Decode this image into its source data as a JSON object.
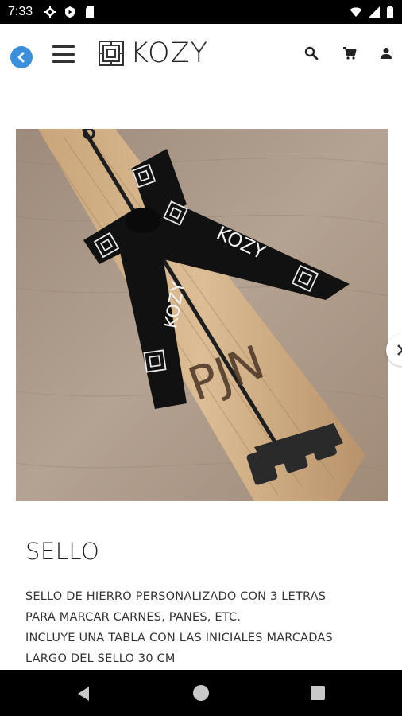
{
  "status_bar": {
    "time": "7:33",
    "left_icons": [
      "settings-icon",
      "play-protect-icon",
      "sd-card-icon"
    ],
    "right_icons": [
      "wifi-icon",
      "signal-icon",
      "battery-icon"
    ]
  },
  "header": {
    "back_icon": "arrow-left-icon",
    "menu_icon": "hamburger-icon",
    "logo_text": "KOZY",
    "actions": [
      "search-icon",
      "cart-icon",
      "user-icon"
    ],
    "accent_color": "#3d8fd9"
  },
  "product": {
    "image_alt": "Sello de hierro con tabla de madera y lazo KOZY",
    "ribbon_text": "KOZY",
    "stamp_letters": "PJN",
    "title": "SELLO",
    "description_lines": [
      "SELLO DE HIERRO PERSONALIZADO CON 3 LETRAS",
      "PARA MARCAR CARNES, PANES, ETC.",
      "INCLUYE UNA TABLA CON LAS INICIALES MARCADAS",
      "LARGO DEL SELLO 30 CM"
    ]
  },
  "nav_bar": {
    "buttons": [
      "back-triangle-icon",
      "home-circle-icon",
      "recents-square-icon"
    ]
  }
}
